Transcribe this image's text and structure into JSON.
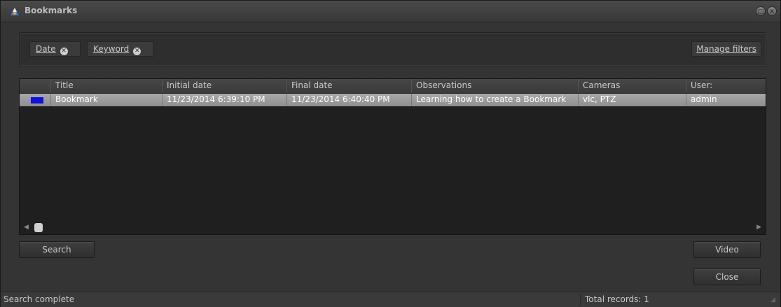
{
  "window": {
    "title": "Bookmarks"
  },
  "filters": {
    "chips": [
      {
        "label": "Date"
      },
      {
        "label": "Keyword"
      }
    ],
    "manage_label": "Manage filters"
  },
  "grid": {
    "columns": [
      "Title",
      "Initial date",
      "Final date",
      "Observations",
      "Cameras",
      "User:"
    ],
    "rows": [
      {
        "color": "#1010e0",
        "title": "Bookmark",
        "initial_date": "11/23/2014 6:39:10 PM",
        "final_date": "11/23/2014 6:40:40 PM",
        "observations": "Learning how to create a Bookmark",
        "cameras": "vlc, PTZ",
        "user": "admin"
      }
    ]
  },
  "buttons": {
    "search": "Search",
    "video": "Video",
    "close": "Close"
  },
  "status": {
    "message": "Search complete",
    "total_records": "Total records: 1"
  }
}
